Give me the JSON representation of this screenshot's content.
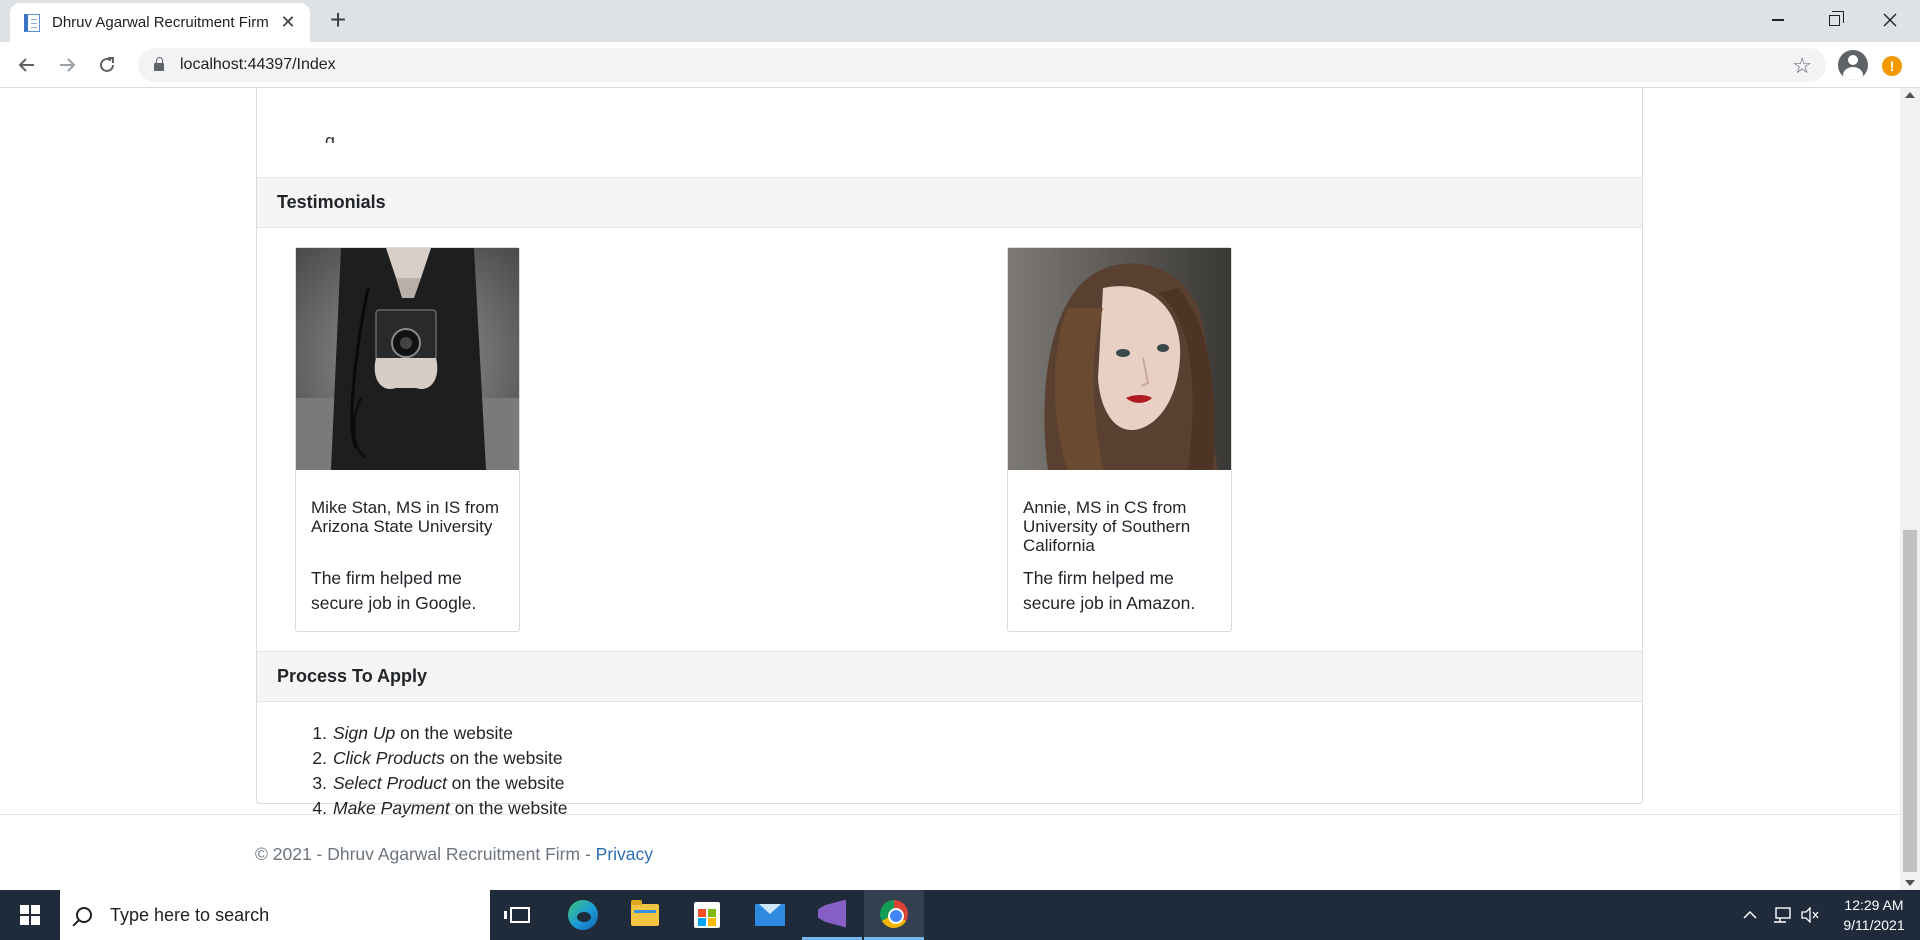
{
  "browser": {
    "tab_title": "Dhruv Agarwal Recruitment Firm",
    "tab_close": "✕",
    "new_tab": "+",
    "url": "localhost:44397/Index",
    "alert": "!"
  },
  "page": {
    "clipped_text": "g",
    "sections": {
      "testimonials": "Testimonials",
      "process": "Process To Apply"
    },
    "testimonials": [
      {
        "name": "Mike Stan, MS in IS from Arizona State University",
        "quote": "The firm helped me secure job in Google."
      },
      {
        "name": "Annie, MS in CS from University of Southern California",
        "quote": "The firm helped me secure job in Amazon."
      }
    ],
    "steps": [
      {
        "num": "1.",
        "action": "Sign Up",
        "rest": " on the website"
      },
      {
        "num": "2.",
        "action": "Click Products",
        "rest": " on the website"
      },
      {
        "num": "3.",
        "action": "Select Product",
        "rest": " on the website"
      },
      {
        "num": "4.",
        "action": "Make Payment",
        "rest": " on the website"
      }
    ],
    "footer": {
      "text": "© 2021 - Dhruv Agarwal Recruitment Firm - ",
      "link": "Privacy"
    }
  },
  "taskbar": {
    "search_placeholder": "Type here to search",
    "clock_time": "12:29 AM",
    "clock_date": "9/11/2021"
  }
}
